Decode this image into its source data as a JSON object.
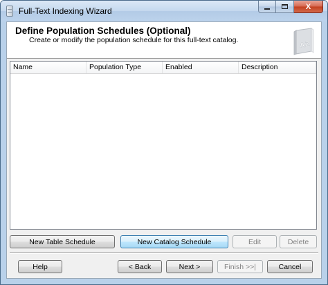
{
  "window": {
    "title": "Full-Text Indexing Wizard",
    "close_glyph": "X"
  },
  "header": {
    "title": "Define Population Schedules (Optional)",
    "description": "Create or modify the population schedule for this full-text catalog.",
    "illustration_icon": "az-catalog-book-icon"
  },
  "list": {
    "columns": [
      "Name",
      "Population Type",
      "Enabled",
      "Description"
    ],
    "rows": []
  },
  "schedule_buttons": {
    "new_table": "New Table Schedule",
    "new_catalog": "New Catalog Schedule",
    "edit": "Edit",
    "delete": "Delete"
  },
  "nav_buttons": {
    "help": "Help",
    "back": "< Back",
    "next": "Next >",
    "finish": "Finish >>|",
    "cancel": "Cancel"
  },
  "colors": {
    "title_bar": "#c4d8ee",
    "close_button": "#c2401f",
    "dialog_background": "#f0f0f0",
    "default_button": "#bee6fd"
  }
}
